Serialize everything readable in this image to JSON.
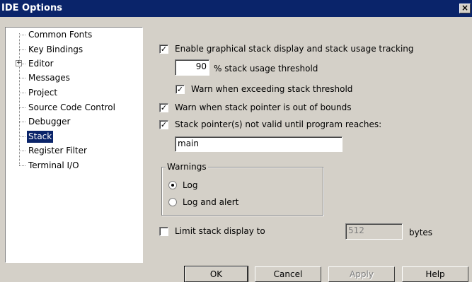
{
  "window": {
    "title": "IDE Options",
    "close_glyph": "×"
  },
  "tree": {
    "items": [
      {
        "label": "Common Fonts"
      },
      {
        "label": "Key Bindings"
      },
      {
        "label": "Editor",
        "expander": "+"
      },
      {
        "label": "Messages"
      },
      {
        "label": "Project"
      },
      {
        "label": "Source Code Control"
      },
      {
        "label": "Debugger"
      },
      {
        "label": "Stack",
        "selected": true
      },
      {
        "label": "Register Filter"
      },
      {
        "label": "Terminal I/O"
      }
    ]
  },
  "stack": {
    "enable_graphical": {
      "label": "Enable graphical stack display and stack usage tracking",
      "checked": true
    },
    "threshold": {
      "value": "90",
      "label": "% stack usage threshold"
    },
    "warn_exceeding": {
      "label": "Warn when exceeding stack threshold",
      "checked": true
    },
    "warn_out_of_bounds": {
      "label": "Warn when stack pointer is out of bounds",
      "checked": true
    },
    "not_valid_until": {
      "label": "Stack pointer(s) not valid until program reaches:",
      "checked": true
    },
    "program_point": {
      "value": "main"
    },
    "warnings": {
      "title": "Warnings",
      "options": [
        {
          "label": "Log",
          "selected": true
        },
        {
          "label": "Log and alert",
          "selected": false
        }
      ]
    },
    "limit_display": {
      "label": "Limit stack display to",
      "checked": false,
      "value": "512",
      "unit": "bytes"
    }
  },
  "buttons": {
    "ok": "OK",
    "cancel": "Cancel",
    "apply": "Apply",
    "help": "Help"
  },
  "glyphs": {
    "check": "✓"
  },
  "colors": {
    "title_bar": "#0a246a",
    "dialog_bg": "#d4d0c8",
    "selection": "#0a246a"
  }
}
